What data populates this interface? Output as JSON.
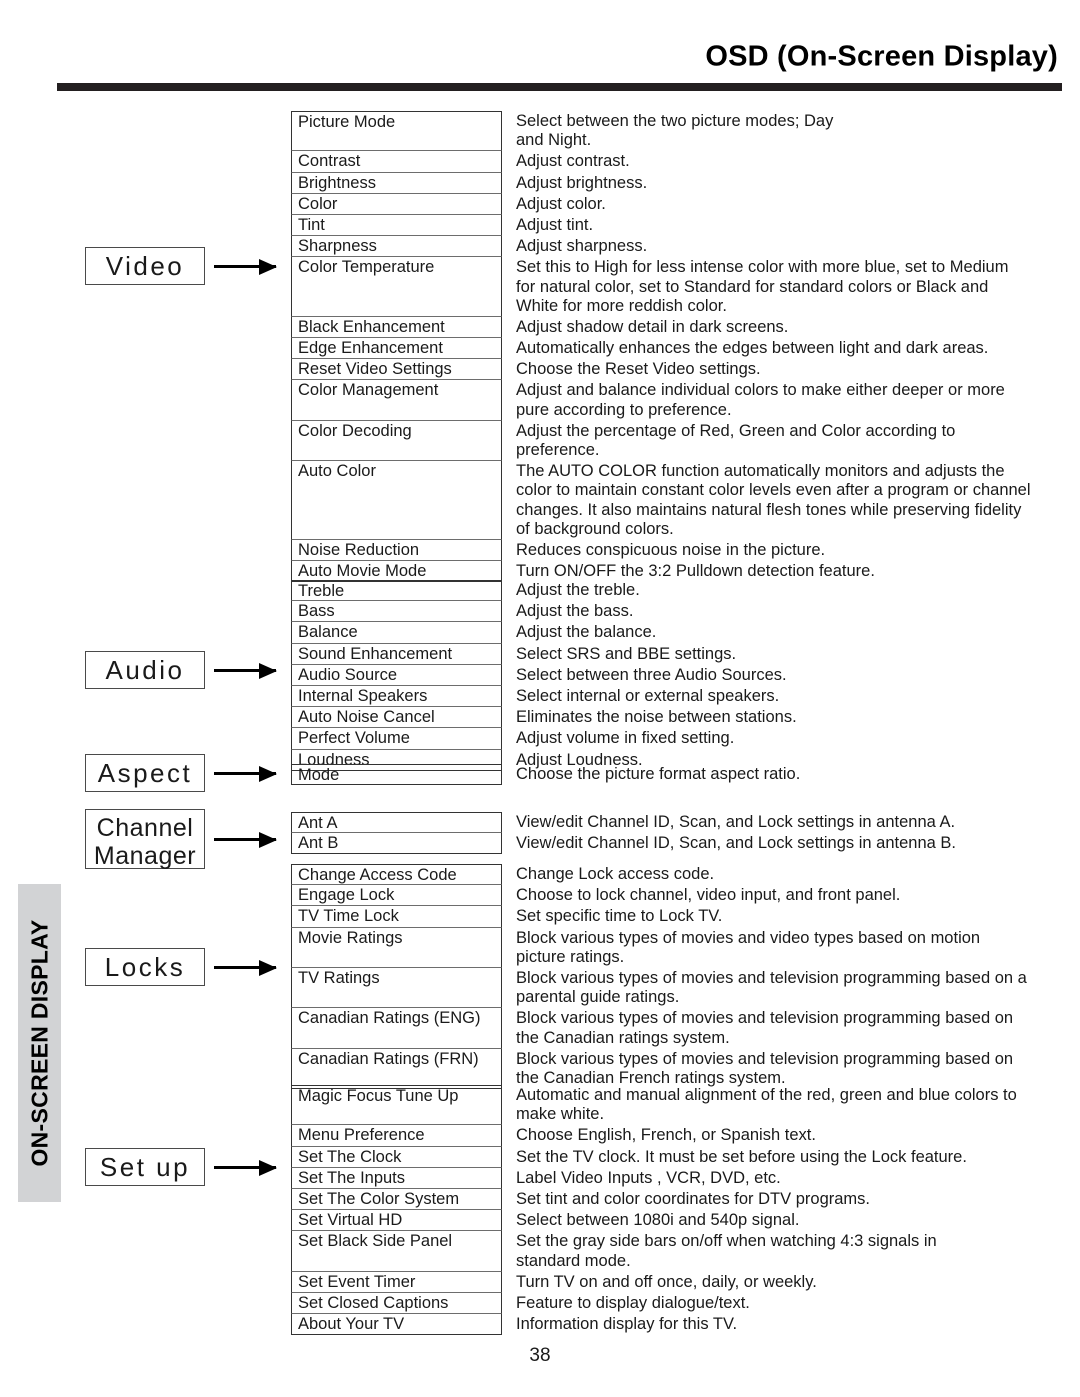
{
  "header": {
    "title": "OSD (On-Screen Display)"
  },
  "side_tab": {
    "label": "ON-SCREEN DISPLAY"
  },
  "page": {
    "number": "38"
  },
  "categories": [
    {
      "id": "video",
      "label": "Video",
      "lines": [
        "Video"
      ]
    },
    {
      "id": "audio",
      "label": "Audio",
      "lines": [
        "Audio"
      ]
    },
    {
      "id": "aspect",
      "label": "Aspect",
      "lines": [
        "Aspect"
      ]
    },
    {
      "id": "channel-manager",
      "label": "Channel Manager",
      "lines": [
        "Channel",
        "Manager"
      ]
    },
    {
      "id": "locks",
      "label": "Locks",
      "lines": [
        "Locks"
      ]
    },
    {
      "id": "setup",
      "label": "Set up",
      "lines": [
        "Set up"
      ]
    }
  ],
  "groups": [
    {
      "id": "video",
      "rows": [
        {
          "name": "Picture Mode",
          "desc": [
            "Select between the two picture modes; Day",
            "and Night."
          ]
        },
        {
          "name": "Contrast",
          "desc": [
            "Adjust contrast."
          ]
        },
        {
          "name": "Brightness",
          "desc": [
            "Adjust brightness."
          ]
        },
        {
          "name": "Color",
          "desc": [
            "Adjust color."
          ]
        },
        {
          "name": "Tint",
          "desc": [
            "Adjust tint."
          ]
        },
        {
          "name": "Sharpness",
          "desc": [
            "Adjust sharpness."
          ]
        },
        {
          "name": "Color Temperature",
          "desc": [
            "Set this to High for less intense color with more blue, set to Medium",
            "for natural color, set to Standard for standard colors or Black and",
            "White for more reddish color."
          ]
        },
        {
          "name": "Black Enhancement",
          "desc": [
            "Adjust shadow detail in dark screens."
          ]
        },
        {
          "name": "Edge Enhancement",
          "desc": [
            "Automatically enhances the edges between light and dark areas."
          ]
        },
        {
          "name": "Reset Video Settings",
          "desc": [
            "Choose the Reset Video settings."
          ]
        },
        {
          "name": "Color Management",
          "desc": [
            "Adjust and balance individual colors to make either deeper or more",
            "pure according to preference."
          ]
        },
        {
          "name": "Color Decoding",
          "desc": [
            "Adjust the percentage of Red, Green and Color according to",
            "preference."
          ]
        },
        {
          "name": "Auto Color",
          "desc": [
            "The AUTO COLOR function automatically monitors and adjusts the",
            "color to maintain constant color levels even after a program or channel",
            "changes. It also maintains natural flesh tones while preserving fidelity",
            "of background colors."
          ]
        },
        {
          "name": "Noise Reduction",
          "desc": [
            "Reduces conspicuous noise in the picture."
          ]
        },
        {
          "name": "Auto Movie Mode",
          "desc": [
            "Turn ON/OFF the 3:2 Pulldown detection feature."
          ]
        }
      ]
    },
    {
      "id": "audio",
      "rows": [
        {
          "name": "Treble",
          "desc": [
            "Adjust the treble."
          ]
        },
        {
          "name": "Bass",
          "desc": [
            "Adjust the bass."
          ]
        },
        {
          "name": "Balance",
          "desc": [
            "Adjust the balance."
          ]
        },
        {
          "name": "Sound Enhancement",
          "desc": [
            "Select SRS and BBE settings."
          ]
        },
        {
          "name": "Audio Source",
          "desc": [
            "Select between three Audio Sources."
          ]
        },
        {
          "name": "Internal Speakers",
          "desc": [
            "Select internal or external speakers."
          ]
        },
        {
          "name": "Auto Noise Cancel",
          "desc": [
            "Eliminates the noise between stations."
          ]
        },
        {
          "name": "Perfect Volume",
          "desc": [
            "Adjust volume in fixed setting."
          ]
        },
        {
          "name": "Loudness",
          "desc": [
            "Adjust Loudness."
          ]
        }
      ]
    },
    {
      "id": "aspect",
      "rows": [
        {
          "name": "Mode",
          "desc": [
            "Choose the picture format aspect ratio."
          ]
        }
      ]
    },
    {
      "id": "channel-manager",
      "rows": [
        {
          "name": "Ant A",
          "desc": [
            "View/edit Channel ID, Scan, and Lock settings in antenna A."
          ]
        },
        {
          "name": "Ant B",
          "desc": [
            "View/edit Channel ID, Scan, and Lock settings in antenna B."
          ]
        }
      ]
    },
    {
      "id": "locks",
      "rows": [
        {
          "name": "Change Access Code",
          "desc": [
            "Change Lock access code."
          ]
        },
        {
          "name": "Engage Lock",
          "desc": [
            "Choose to lock channel, video input, and front panel."
          ]
        },
        {
          "name": "TV Time Lock",
          "desc": [
            "Set specific time to Lock TV."
          ]
        },
        {
          "name": "Movie Ratings",
          "desc": [
            "Block various types of movies and video types based on motion",
            "picture ratings."
          ]
        },
        {
          "name": "TV Ratings",
          "desc": [
            "Block various types of movies and television programming based on a",
            "parental guide ratings."
          ]
        },
        {
          "name": "Canadian Ratings (ENG)",
          "desc": [
            "Block various types of movies and television programming based on",
            "the Canadian ratings system."
          ]
        },
        {
          "name": "Canadian Ratings (FRN)",
          "desc": [
            "Block various types of movies and television programming based on",
            "the Canadian French ratings system."
          ]
        }
      ]
    },
    {
      "id": "setup",
      "rows": [
        {
          "name": "Magic Focus Tune Up",
          "desc": [
            "Automatic and manual alignment of the red, green and blue colors to",
            "make white."
          ]
        },
        {
          "name": "Menu Preference",
          "desc": [
            "Choose English, French, or Spanish text."
          ]
        },
        {
          "name": "Set The Clock",
          "desc": [
            "Set the TV clock.  It must be set before using the Lock feature."
          ]
        },
        {
          "name": "Set The Inputs",
          "desc": [
            "Label Video Inputs , VCR, DVD, etc."
          ]
        },
        {
          "name": "Set The Color System",
          "desc": [
            "Set tint and color coordinates for DTV programs."
          ]
        },
        {
          "name": "Set Virtual HD",
          "desc": [
            "Select between 1080i and 540p signal."
          ]
        },
        {
          "name": "Set Black Side Panel",
          "desc": [
            "Set the gray side bars on/off when watching 4:3 signals in",
            "standard mode."
          ]
        },
        {
          "name": "Set Event Timer",
          "desc": [
            "Turn TV on and off once, daily, or weekly."
          ]
        },
        {
          "name": "Set Closed Captions",
          "desc": [
            "Feature to display dialogue/text."
          ]
        },
        {
          "name": "About Your TV",
          "desc": [
            "Information display for this TV."
          ]
        }
      ]
    }
  ]
}
